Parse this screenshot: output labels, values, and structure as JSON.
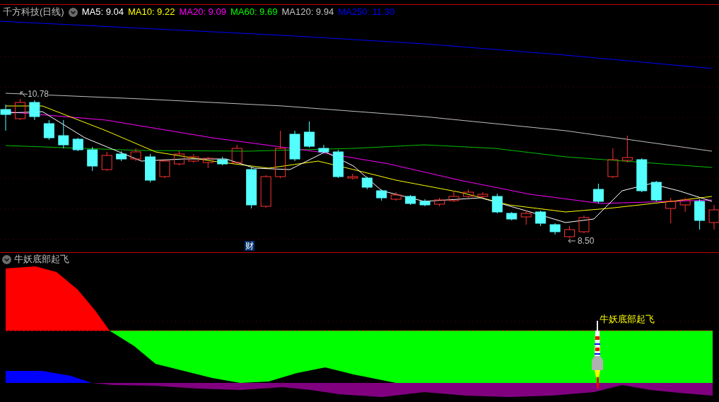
{
  "header": {
    "title": "千方科技(日线)",
    "ma": [
      {
        "label": "MA5: 9.04",
        "color": "#ffffff"
      },
      {
        "label": "MA10: 9.22",
        "color": "#ffff00"
      },
      {
        "label": "MA20: 9.09",
        "color": "#ff00ff"
      },
      {
        "label": "MA60: 9.69",
        "color": "#00ff00"
      },
      {
        "label": "MA120: 9.94",
        "color": "#c0c0c0"
      },
      {
        "label": "MA250: 11.30",
        "color": "#0000ff"
      }
    ]
  },
  "main_chart": {
    "high_label": "10.78",
    "low_label": "8.50",
    "marker": "财"
  },
  "indicator": {
    "title": "牛妖底部起飞",
    "signal_label": "牛妖底部起飞"
  }
}
